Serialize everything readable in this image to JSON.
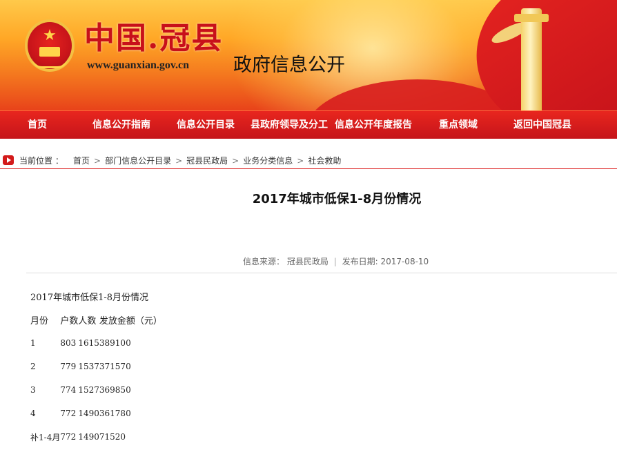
{
  "header": {
    "site_name": "中国.冠县",
    "site_url": "www.guanxian.gov.cn",
    "site_subtitle": "政府信息公开"
  },
  "nav": {
    "items": [
      {
        "label": "首页"
      },
      {
        "label": "信息公开指南"
      },
      {
        "label": "信息公开目录"
      },
      {
        "label": "县政府领导及分工"
      },
      {
        "label": "信息公开年度报告"
      },
      {
        "label": "重点领域"
      },
      {
        "label": "返回中国冠县"
      }
    ]
  },
  "breadcrumb": {
    "label": "当前位置 ：",
    "items": [
      {
        "label": "首页"
      },
      {
        "label": "部门信息公开目录"
      },
      {
        "label": "冠县民政局"
      },
      {
        "label": "业务分类信息"
      },
      {
        "label": "社会救助"
      }
    ]
  },
  "article": {
    "title": "2017年城市低保1-8月份情况",
    "source_label": "信息来源：",
    "source_value": "冠县民政局",
    "date_label": "发布日期:",
    "date_value": "2017-08-10",
    "content_heading": "2017年城市低保1-8月份情况",
    "table": {
      "headers": [
        "月份",
        "户数",
        "人数",
        "发放金额（元）"
      ],
      "rows": [
        [
          "1",
          "803",
          "1615",
          "389100"
        ],
        [
          "2",
          "779",
          "1537",
          "371570"
        ],
        [
          "3",
          "774",
          "1527",
          "369850"
        ],
        [
          "4",
          "772",
          "1490",
          "361780"
        ],
        [
          "补1-4月",
          "772",
          "1490",
          "71520"
        ]
      ]
    }
  },
  "colors": {
    "brand_red": "#c8141a",
    "nav_red": "#e8261e",
    "banner_orange": "#f57c1f"
  },
  "icons": {
    "breadcrumb_marker": "play-icon",
    "emblem": "national-emblem-icon"
  }
}
